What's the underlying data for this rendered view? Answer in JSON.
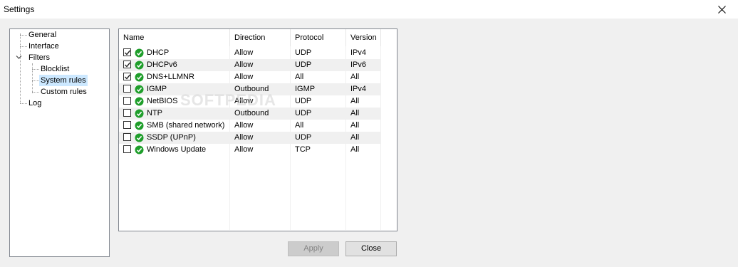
{
  "window": {
    "title": "Settings"
  },
  "tree": {
    "items": [
      {
        "label": "General"
      },
      {
        "label": "Interface"
      },
      {
        "label": "Filters"
      },
      {
        "label": "Blocklist"
      },
      {
        "label": "System rules"
      },
      {
        "label": "Custom rules"
      },
      {
        "label": "Log"
      }
    ],
    "selected": "System rules"
  },
  "table": {
    "columns": [
      "Name",
      "Direction",
      "Protocol",
      "Version"
    ],
    "rows": [
      {
        "checked": true,
        "name": "DHCP",
        "direction": "Allow",
        "protocol": "UDP",
        "version": "IPv4"
      },
      {
        "checked": true,
        "name": "DHCPv6",
        "direction": "Allow",
        "protocol": "UDP",
        "version": "IPv6"
      },
      {
        "checked": true,
        "name": "DNS+LLMNR",
        "direction": "Allow",
        "protocol": "All",
        "version": "All"
      },
      {
        "checked": false,
        "name": "IGMP",
        "direction": "Outbound",
        "protocol": "IGMP",
        "version": "IPv4"
      },
      {
        "checked": false,
        "name": "NetBIOS",
        "direction": "Allow",
        "protocol": "UDP",
        "version": "All"
      },
      {
        "checked": false,
        "name": "NTP",
        "direction": "Outbound",
        "protocol": "UDP",
        "version": "All"
      },
      {
        "checked": false,
        "name": "SMB (shared network)",
        "direction": "Allow",
        "protocol": "All",
        "version": "All"
      },
      {
        "checked": false,
        "name": "SSDP (UPnP)",
        "direction": "Allow",
        "protocol": "UDP",
        "version": "All"
      },
      {
        "checked": false,
        "name": "Windows Update",
        "direction": "Allow",
        "protocol": "TCP",
        "version": "All"
      }
    ]
  },
  "buttons": {
    "apply": "Apply",
    "close": "Close"
  },
  "watermark": "SOFTPEDIA",
  "colors": {
    "selection": "#cce8ff",
    "ok_green": "#1f9e2b"
  }
}
